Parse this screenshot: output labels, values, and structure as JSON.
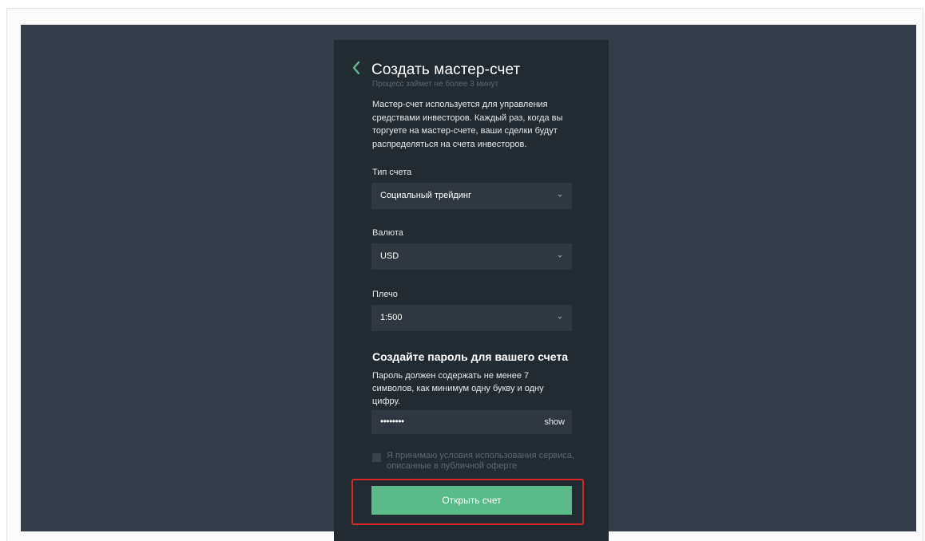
{
  "form": {
    "title": "Создать мастер-счет",
    "subtitle": "Процесс займет не более 3 минут",
    "description": "Мастер-счет используется для управления средствами инвесторов. Каждый раз, когда вы торгуете на мастер-счете, ваши сделки будут распределяться на счета инвесторов.",
    "account_type": {
      "label": "Тип счета",
      "value": "Социальный трейдинг"
    },
    "currency": {
      "label": "Валюта",
      "value": "USD"
    },
    "leverage": {
      "label": "Плечо",
      "value": "1:500"
    },
    "password": {
      "heading": "Создайте пароль для вашего счета",
      "hint": "Пароль должен содержать не менее 7 символов, как минимум одну букву и одну цифру.",
      "masked_value": "••••••••",
      "show_label": "show"
    },
    "terms_label": "Я принимаю условия использования сервиса, описанные в публичной оферте",
    "terms_checked": false,
    "submit_label": "Открыть счет"
  },
  "colors": {
    "accent": "#5bba8a",
    "highlight": "#d8262a",
    "panel": "#232b32",
    "stage": "#353e48"
  },
  "icons": {
    "back": "chevron-left-icon",
    "dropdown": "chevron-down-icon"
  }
}
